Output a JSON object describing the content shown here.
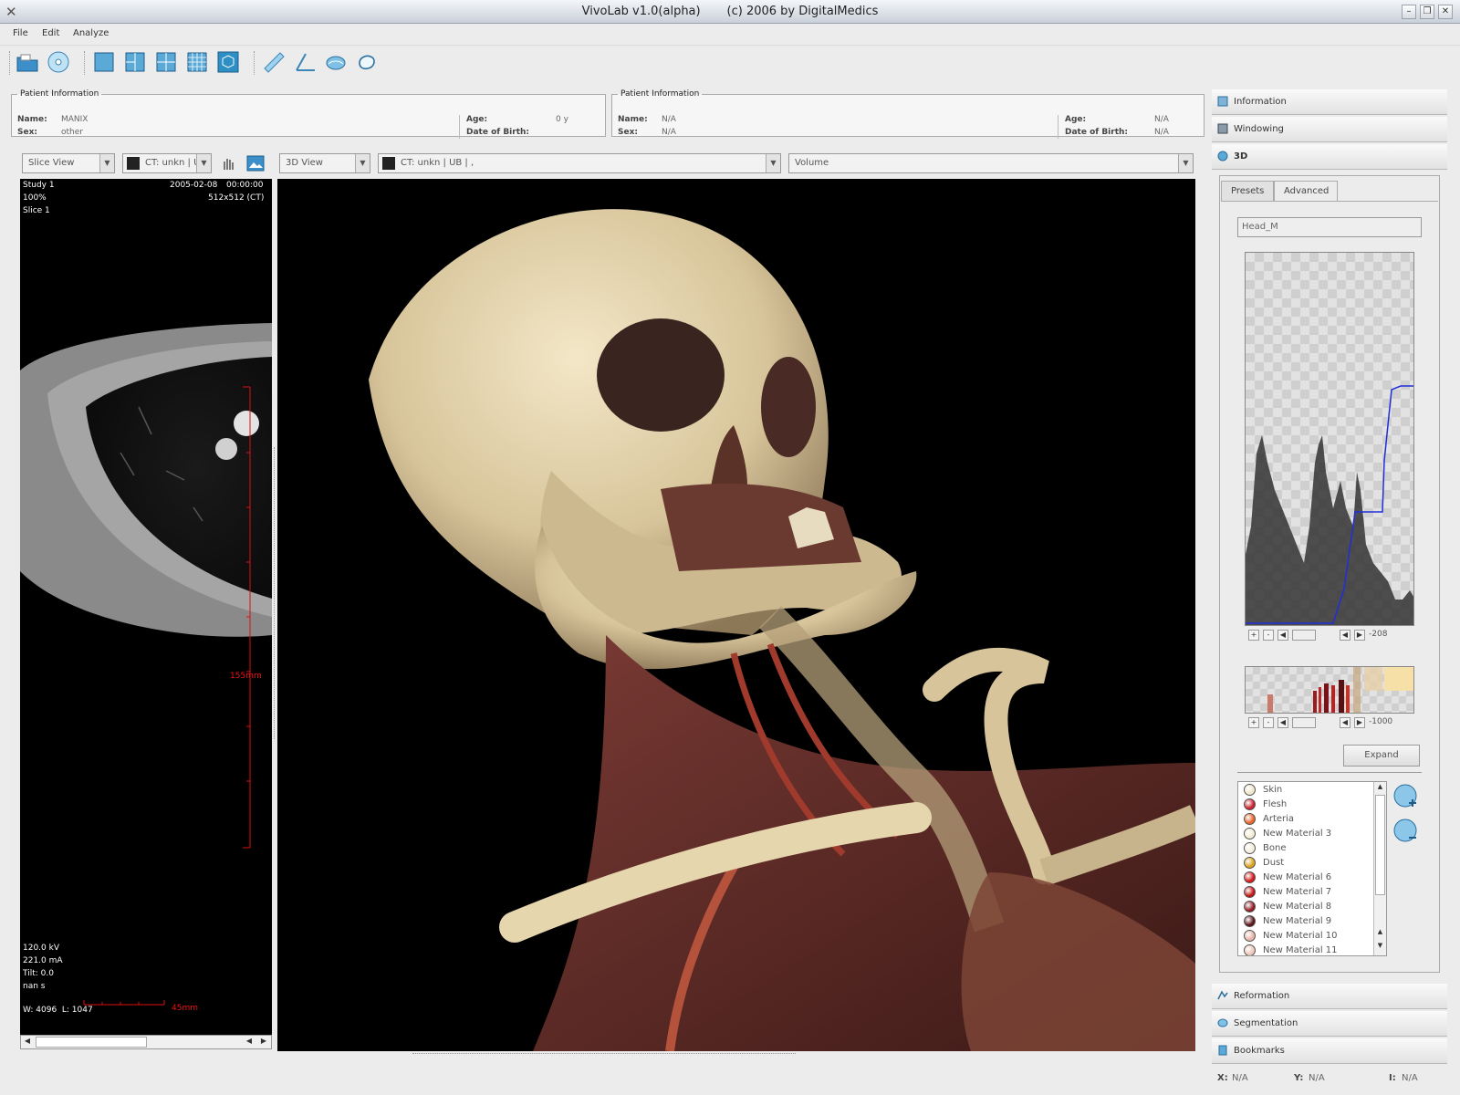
{
  "window": {
    "title": "VivoLab v1.0(alpha)       (c) 2006 by DigitalMedics"
  },
  "menu": [
    "File",
    "Edit",
    "Analyze"
  ],
  "toolbar_icons": [
    "open-folder-icon",
    "cd-disc-icon",
    "single-view-icon",
    "split-view-icon",
    "quad-view-icon",
    "grid-view-icon",
    "3d-cube-icon",
    "ruler-icon",
    "angle-icon",
    "freehand-area-icon",
    "closed-curve-icon"
  ],
  "patient_left": {
    "legend": "Patient Information",
    "name_label": "Name:",
    "name": "MANIX",
    "sex_label": "Sex:",
    "sex": "other",
    "age_label": "Age:",
    "age": "0 y",
    "dob_label": "Date of Birth:",
    "dob": ""
  },
  "patient_right": {
    "legend": "Patient Information",
    "name_label": "Name:",
    "name": "N/A",
    "sex_label": "Sex:",
    "sex": "N/A",
    "age_label": "Age:",
    "age": "N/A",
    "dob_label": "Date of Birth:",
    "dob": "N/A"
  },
  "slice_view": {
    "view_select": "Slice View",
    "series_select": "CT: unkn | U",
    "study": "Study 1",
    "date": "2005-02-08",
    "time": "00:00:00",
    "zoom": "100%",
    "matrix": "512x512 (CT)",
    "slice": "Slice 1",
    "kv": "120.0 kV",
    "ma": "221.0 mA",
    "tilt": "Tilt: 0.0",
    "time_s": "nan s",
    "window_level": "W: 4096  L: 1047",
    "scale_v": "155mm",
    "scale_h": "45mm"
  },
  "view_3d": {
    "view_select": "3D View",
    "series_select": "CT: unkn | UB | ,",
    "mode_select": "Volume"
  },
  "right_panel": {
    "sections_top": [
      {
        "label": "Information",
        "icon": "info-icon"
      },
      {
        "label": "Windowing",
        "icon": "windowing-icon"
      },
      {
        "label": "3D",
        "icon": "sphere-3d-icon"
      }
    ],
    "tabs": [
      "Presets",
      "Advanced"
    ],
    "active_tab": "Advanced",
    "preset_name": "Head_M",
    "histogram_value": "-208",
    "colormap_value": "-1000",
    "expand_label": "Expand",
    "materials": [
      {
        "name": "Skin",
        "color": "#f1e6c8"
      },
      {
        "name": "Flesh",
        "color": "#c81e2c"
      },
      {
        "name": "Arteria",
        "color": "#e8642a"
      },
      {
        "name": "New Material 3",
        "color": "#f3ecd2"
      },
      {
        "name": "Bone",
        "color": "#f4eedc"
      },
      {
        "name": "Dust",
        "color": "#d9a21c"
      },
      {
        "name": "New Material 6",
        "color": "#d11818"
      },
      {
        "name": "New Material 7",
        "color": "#c01414"
      },
      {
        "name": "New Material 8",
        "color": "#8e1b22"
      },
      {
        "name": "New Material 9",
        "color": "#5a1218"
      },
      {
        "name": "New Material 10",
        "color": "#e7b3a6"
      },
      {
        "name": "New Material 11",
        "color": "#eec7b8"
      }
    ],
    "sections_bottom": [
      {
        "label": "Reformation",
        "icon": "reformation-icon"
      },
      {
        "label": "Segmentation",
        "icon": "segmentation-icon"
      },
      {
        "label": "Bookmarks",
        "icon": "bookmarks-icon"
      }
    ]
  },
  "status": {
    "x_label": "X:",
    "x": "N/A",
    "y_label": "Y:",
    "y": "N/A",
    "i_label": "I:",
    "i": "N/A"
  }
}
